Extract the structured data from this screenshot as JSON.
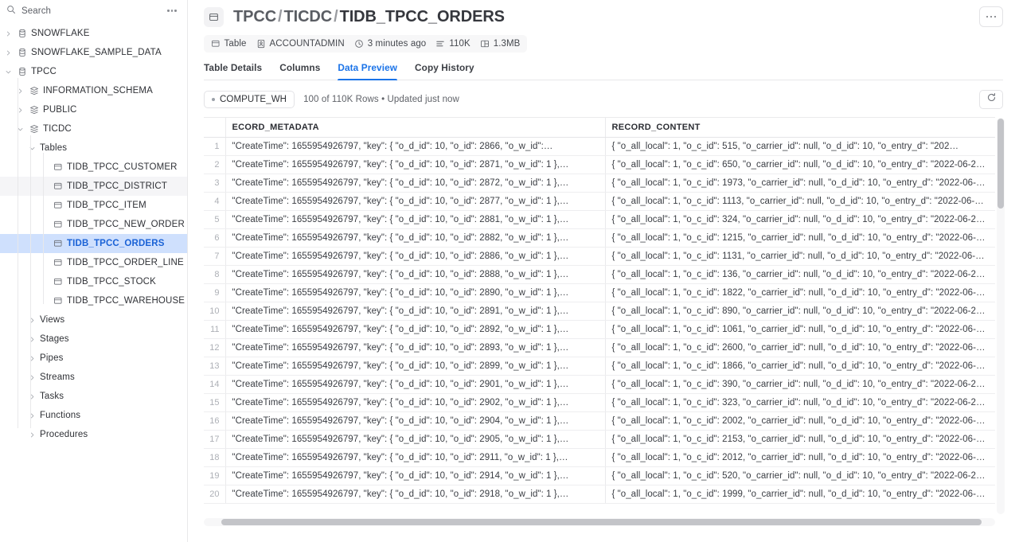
{
  "sidebar": {
    "search": {
      "placeholder": "Search",
      "icon": "search-icon"
    },
    "more_icon": "ellipsis-icon",
    "tree": [
      {
        "label": "SNOWFLAKE",
        "level": 0,
        "icon": "database-icon",
        "expanded": false,
        "chevron": "chevron-right-icon",
        "selected": false
      },
      {
        "label": "SNOWFLAKE_SAMPLE_DATA",
        "level": 0,
        "icon": "database-icon",
        "expanded": false,
        "chevron": "chevron-right-icon",
        "selected": false
      },
      {
        "label": "TPCC",
        "level": 0,
        "icon": "database-icon",
        "expanded": true,
        "chevron": "chevron-down-icon",
        "selected": false
      },
      {
        "label": "INFORMATION_SCHEMA",
        "level": 1,
        "icon": "schema-icon",
        "expanded": false,
        "chevron": "chevron-right-icon",
        "selected": false
      },
      {
        "label": "PUBLIC",
        "level": 1,
        "icon": "schema-icon",
        "expanded": false,
        "chevron": "chevron-right-icon",
        "selected": false
      },
      {
        "label": "TICDC",
        "level": 1,
        "icon": "schema-icon",
        "expanded": true,
        "chevron": "chevron-down-icon",
        "selected": false
      },
      {
        "label": "Tables",
        "level": 2,
        "icon": "none",
        "expanded": true,
        "chevron": "chevron-down-icon",
        "selected": false
      },
      {
        "label": "TIDB_TPCC_CUSTOMER",
        "level": 3,
        "icon": "table-icon",
        "expanded": null,
        "chevron": "none",
        "selected": false
      },
      {
        "label": "TIDB_TPCC_DISTRICT",
        "level": 3,
        "icon": "table-icon",
        "expanded": null,
        "chevron": "none",
        "selected": false,
        "hovered": true
      },
      {
        "label": "TIDB_TPCC_ITEM",
        "level": 3,
        "icon": "table-icon",
        "expanded": null,
        "chevron": "none",
        "selected": false
      },
      {
        "label": "TIDB_TPCC_NEW_ORDER",
        "level": 3,
        "icon": "table-icon",
        "expanded": null,
        "chevron": "none",
        "selected": false
      },
      {
        "label": "TIDB_TPCC_ORDERS",
        "level": 3,
        "icon": "table-icon",
        "expanded": null,
        "chevron": "none",
        "selected": true
      },
      {
        "label": "TIDB_TPCC_ORDER_LINE",
        "level": 3,
        "icon": "table-icon",
        "expanded": null,
        "chevron": "none",
        "selected": false
      },
      {
        "label": "TIDB_TPCC_STOCK",
        "level": 3,
        "icon": "table-icon",
        "expanded": null,
        "chevron": "none",
        "selected": false
      },
      {
        "label": "TIDB_TPCC_WAREHOUSE",
        "level": 3,
        "icon": "table-icon",
        "expanded": null,
        "chevron": "none",
        "selected": false
      },
      {
        "label": "Views",
        "level": 2,
        "icon": "none",
        "expanded": false,
        "chevron": "chevron-right-icon",
        "selected": false
      },
      {
        "label": "Stages",
        "level": 2,
        "icon": "none",
        "expanded": false,
        "chevron": "chevron-right-icon",
        "selected": false
      },
      {
        "label": "Pipes",
        "level": 2,
        "icon": "none",
        "expanded": false,
        "chevron": "chevron-right-icon",
        "selected": false
      },
      {
        "label": "Streams",
        "level": 2,
        "icon": "none",
        "expanded": false,
        "chevron": "chevron-right-icon",
        "selected": false
      },
      {
        "label": "Tasks",
        "level": 2,
        "icon": "none",
        "expanded": false,
        "chevron": "chevron-right-icon",
        "selected": false
      },
      {
        "label": "Functions",
        "level": 2,
        "icon": "none",
        "expanded": false,
        "chevron": "chevron-right-icon",
        "selected": false
      },
      {
        "label": "Procedures",
        "level": 2,
        "icon": "none",
        "expanded": false,
        "chevron": "chevron-right-icon",
        "selected": false
      }
    ]
  },
  "header": {
    "badge_icon": "table-icon",
    "breadcrumb": {
      "database": "TPCC",
      "schema": "TICDC",
      "table": "TIDB_TPCC_ORDERS",
      "separator": "/"
    },
    "more_icon": "ellipsis-icon",
    "meta": [
      {
        "icon": "table-icon",
        "label": "Table"
      },
      {
        "icon": "user-badge-icon",
        "label": "ACCOUNTADMIN"
      },
      {
        "icon": "clock-icon",
        "label": "3 minutes ago"
      },
      {
        "icon": "rows-icon",
        "label": "110K"
      },
      {
        "icon": "storage-icon",
        "label": "1.3MB"
      }
    ],
    "tabs": [
      {
        "label": "Table Details",
        "active": false
      },
      {
        "label": "Columns",
        "active": false
      },
      {
        "label": "Data Preview",
        "active": true
      },
      {
        "label": "Copy History",
        "active": false
      }
    ],
    "accent_color": "#1a73e8"
  },
  "toolbar": {
    "warehouse": "COMPUTE_WH",
    "rows_info": "100 of 110K Rows • Updated just now",
    "refresh_icon": "refresh-icon"
  },
  "table": {
    "columns": [
      "RECORD_METADATA",
      "RECORD_CONTENT"
    ],
    "header_clipped": "ECORD_METADATA",
    "rows": [
      {
        "n": "1",
        "metadata": "\"CreateTime\": 1655954926797,  \"key\": {    \"o_d_id\": 10,    \"o_id\": 2866,    \"o_w_id\":…",
        "content": "{   \"o_all_local\": 1,   \"o_c_id\": 515,   \"o_carrier_id\": null,   \"o_d_id\": 10,   \"o_entry_d\": \"202…"
      },
      {
        "n": "2",
        "metadata": "\"CreateTime\": 1655954926797,  \"key\": {    \"o_d_id\": 10,    \"o_id\": 2871,    \"o_w_id\": 1  },…",
        "content": "{   \"o_all_local\": 1,   \"o_c_id\": 650,   \"o_carrier_id\": null,   \"o_d_id\": 10,   \"o_entry_d\": \"2022-06-2…"
      },
      {
        "n": "3",
        "metadata": "\"CreateTime\": 1655954926797,  \"key\": {    \"o_d_id\": 10,    \"o_id\": 2872,    \"o_w_id\": 1  },…",
        "content": "{   \"o_all_local\": 1,   \"o_c_id\": 1973,   \"o_carrier_id\": null,   \"o_d_id\": 10,   \"o_entry_d\": \"2022-06-…"
      },
      {
        "n": "4",
        "metadata": "\"CreateTime\": 1655954926797,  \"key\": {    \"o_d_id\": 10,    \"o_id\": 2877,    \"o_w_id\": 1  },…",
        "content": "{   \"o_all_local\": 1,   \"o_c_id\": 1113,   \"o_carrier_id\": null,   \"o_d_id\": 10,   \"o_entry_d\": \"2022-06-…"
      },
      {
        "n": "5",
        "metadata": "\"CreateTime\": 1655954926797,  \"key\": {    \"o_d_id\": 10,    \"o_id\": 2881,    \"o_w_id\": 1  },…",
        "content": "{   \"o_all_local\": 1,   \"o_c_id\": 324,   \"o_carrier_id\": null,   \"o_d_id\": 10,   \"o_entry_d\": \"2022-06-2…"
      },
      {
        "n": "6",
        "metadata": "\"CreateTime\": 1655954926797,  \"key\": {    \"o_d_id\": 10,    \"o_id\": 2882,    \"o_w_id\": 1  },…",
        "content": "{   \"o_all_local\": 1,   \"o_c_id\": 1215,   \"o_carrier_id\": null,   \"o_d_id\": 10,   \"o_entry_d\": \"2022-06-…"
      },
      {
        "n": "7",
        "metadata": "\"CreateTime\": 1655954926797,  \"key\": {    \"o_d_id\": 10,    \"o_id\": 2886,    \"o_w_id\": 1  },…",
        "content": "{   \"o_all_local\": 1,   \"o_c_id\": 1131,   \"o_carrier_id\": null,   \"o_d_id\": 10,   \"o_entry_d\": \"2022-06-…"
      },
      {
        "n": "8",
        "metadata": "\"CreateTime\": 1655954926797,  \"key\": {    \"o_d_id\": 10,    \"o_id\": 2888,    \"o_w_id\": 1  },…",
        "content": "{   \"o_all_local\": 1,   \"o_c_id\": 136,   \"o_carrier_id\": null,   \"o_d_id\": 10,   \"o_entry_d\": \"2022-06-2…"
      },
      {
        "n": "9",
        "metadata": "\"CreateTime\": 1655954926797,  \"key\": {    \"o_d_id\": 10,    \"o_id\": 2890,    \"o_w_id\": 1  },…",
        "content": "{   \"o_all_local\": 1,   \"o_c_id\": 1822,   \"o_carrier_id\": null,   \"o_d_id\": 10,   \"o_entry_d\": \"2022-06-…"
      },
      {
        "n": "10",
        "metadata": "\"CreateTime\": 1655954926797,  \"key\": {    \"o_d_id\": 10,    \"o_id\": 2891,    \"o_w_id\": 1  },…",
        "content": "{   \"o_all_local\": 1,   \"o_c_id\": 890,   \"o_carrier_id\": null,   \"o_d_id\": 10,   \"o_entry_d\": \"2022-06-2…"
      },
      {
        "n": "11",
        "metadata": "\"CreateTime\": 1655954926797,  \"key\": {    \"o_d_id\": 10,    \"o_id\": 2892,    \"o_w_id\": 1  },…",
        "content": "{   \"o_all_local\": 1,   \"o_c_id\": 1061,   \"o_carrier_id\": null,   \"o_d_id\": 10,   \"o_entry_d\": \"2022-06-…"
      },
      {
        "n": "12",
        "metadata": "\"CreateTime\": 1655954926797,  \"key\": {    \"o_d_id\": 10,    \"o_id\": 2893,    \"o_w_id\": 1  },…",
        "content": "{   \"o_all_local\": 1,   \"o_c_id\": 2600,   \"o_carrier_id\": null,   \"o_d_id\": 10,   \"o_entry_d\": \"2022-06-…"
      },
      {
        "n": "13",
        "metadata": "\"CreateTime\": 1655954926797,  \"key\": {    \"o_d_id\": 10,    \"o_id\": 2899,    \"o_w_id\": 1  },…",
        "content": "{   \"o_all_local\": 1,   \"o_c_id\": 1866,   \"o_carrier_id\": null,   \"o_d_id\": 10,   \"o_entry_d\": \"2022-06-…"
      },
      {
        "n": "14",
        "metadata": "\"CreateTime\": 1655954926797,  \"key\": {    \"o_d_id\": 10,    \"o_id\": 2901,    \"o_w_id\": 1  },…",
        "content": "{   \"o_all_local\": 1,   \"o_c_id\": 390,   \"o_carrier_id\": null,   \"o_d_id\": 10,   \"o_entry_d\": \"2022-06-2…"
      },
      {
        "n": "15",
        "metadata": "\"CreateTime\": 1655954926797,  \"key\": {    \"o_d_id\": 10,    \"o_id\": 2902,    \"o_w_id\": 1  },…",
        "content": "{   \"o_all_local\": 1,   \"o_c_id\": 323,   \"o_carrier_id\": null,   \"o_d_id\": 10,   \"o_entry_d\": \"2022-06-2…"
      },
      {
        "n": "16",
        "metadata": "\"CreateTime\": 1655954926797,  \"key\": {    \"o_d_id\": 10,    \"o_id\": 2904,    \"o_w_id\": 1  },…",
        "content": "{   \"o_all_local\": 1,   \"o_c_id\": 2002,   \"o_carrier_id\": null,   \"o_d_id\": 10,   \"o_entry_d\": \"2022-06-…"
      },
      {
        "n": "17",
        "metadata": "\"CreateTime\": 1655954926797,  \"key\": {    \"o_d_id\": 10,    \"o_id\": 2905,    \"o_w_id\": 1  },…",
        "content": "{   \"o_all_local\": 1,   \"o_c_id\": 2153,   \"o_carrier_id\": null,   \"o_d_id\": 10,   \"o_entry_d\": \"2022-06-…"
      },
      {
        "n": "18",
        "metadata": "\"CreateTime\": 1655954926797,  \"key\": {    \"o_d_id\": 10,    \"o_id\": 2911,    \"o_w_id\": 1  },…",
        "content": "{   \"o_all_local\": 1,   \"o_c_id\": 2012,   \"o_carrier_id\": null,   \"o_d_id\": 10,   \"o_entry_d\": \"2022-06-…"
      },
      {
        "n": "19",
        "metadata": "\"CreateTime\": 1655954926797,  \"key\": {    \"o_d_id\": 10,    \"o_id\": 2914,    \"o_w_id\": 1  },…",
        "content": "{   \"o_all_local\": 1,   \"o_c_id\": 520,   \"o_carrier_id\": null,   \"o_d_id\": 10,   \"o_entry_d\": \"2022-06-2…"
      },
      {
        "n": "20",
        "metadata": "\"CreateTime\": 1655954926797,  \"key\": {    \"o_d_id\": 10,    \"o_id\": 2918,    \"o_w_id\": 1  },…",
        "content": "{   \"o_all_local\": 1,   \"o_c_id\": 1999,   \"o_carrier_id\": null,   \"o_d_id\": 10,   \"o_entry_d\": \"2022-06-…"
      }
    ]
  }
}
